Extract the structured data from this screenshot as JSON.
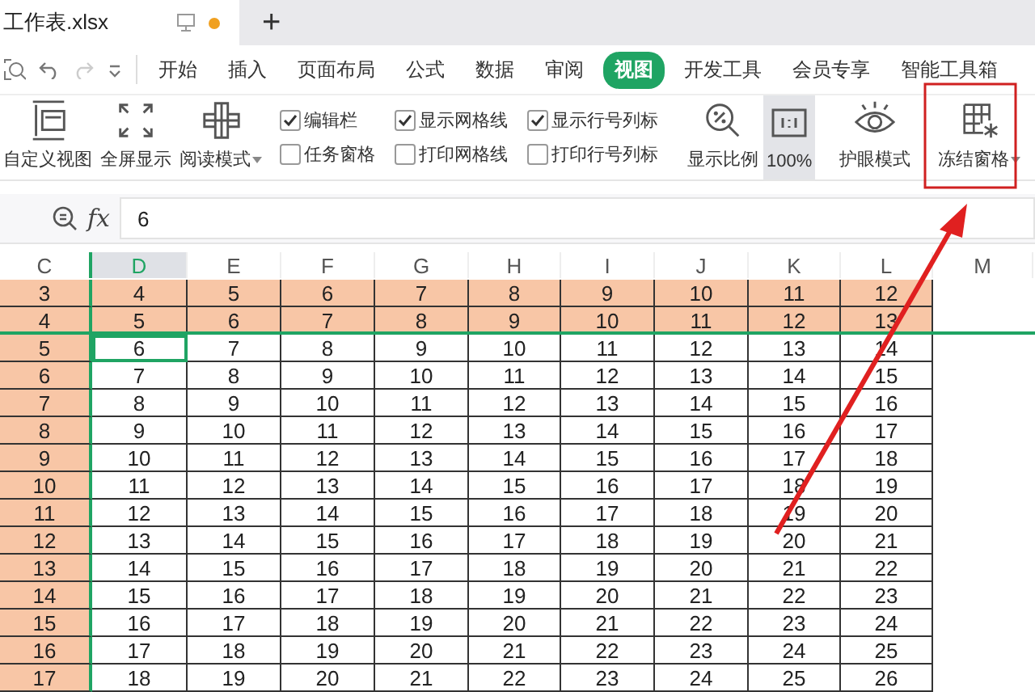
{
  "document_tab": {
    "title": "工作表.xlsx",
    "modified": true
  },
  "new_tab_button": "+",
  "menu_tabs": [
    {
      "label": "开始",
      "selected": false
    },
    {
      "label": "插入",
      "selected": false
    },
    {
      "label": "页面布局",
      "selected": false
    },
    {
      "label": "公式",
      "selected": false
    },
    {
      "label": "数据",
      "selected": false
    },
    {
      "label": "审阅",
      "selected": false
    },
    {
      "label": "视图",
      "selected": true
    },
    {
      "label": "开发工具",
      "selected": false
    },
    {
      "label": "会员专享",
      "selected": false
    },
    {
      "label": "智能工具箱",
      "selected": false
    }
  ],
  "ribbon": [
    {
      "kind": "button",
      "label": "自定义视图",
      "dropdown": false,
      "pressed": false
    },
    {
      "kind": "button",
      "label": "全屏显示",
      "dropdown": false,
      "pressed": false
    },
    {
      "kind": "button",
      "label": "阅读模式",
      "dropdown": true,
      "pressed": false
    },
    {
      "kind": "check",
      "label": "编辑栏",
      "checked": true
    },
    {
      "kind": "check",
      "label": "任务窗格",
      "checked": false
    },
    {
      "kind": "check",
      "label": "显示网格线",
      "checked": true
    },
    {
      "kind": "check",
      "label": "打印网格线",
      "checked": false
    },
    {
      "kind": "check",
      "label": "显示行号列标",
      "checked": true
    },
    {
      "kind": "check",
      "label": "打印行号列标",
      "checked": false
    },
    {
      "kind": "button",
      "label": "显示比例",
      "dropdown": false,
      "pressed": false
    },
    {
      "kind": "button",
      "label": "100%",
      "dropdown": false,
      "pressed": true
    },
    {
      "kind": "button",
      "label": "护眼模式",
      "dropdown": false,
      "pressed": false
    },
    {
      "kind": "button",
      "label": "冻结窗格",
      "dropdown": true,
      "pressed": false
    }
  ],
  "formula_bar": {
    "fx": "fx",
    "value": "6"
  },
  "sheet": {
    "columns": [
      {
        "label": "C",
        "selected": false,
        "frozen": true,
        "shaded": true
      },
      {
        "label": "D",
        "selected": true,
        "frozen": false,
        "shaded": false
      },
      {
        "label": "E",
        "selected": false,
        "frozen": false,
        "shaded": false
      },
      {
        "label": "F",
        "selected": false,
        "frozen": false,
        "shaded": false
      },
      {
        "label": "G",
        "selected": false,
        "frozen": false,
        "shaded": false
      },
      {
        "label": "H",
        "selected": false,
        "frozen": false,
        "shaded": false
      },
      {
        "label": "I",
        "selected": false,
        "frozen": false,
        "shaded": false
      },
      {
        "label": "J",
        "selected": false,
        "frozen": false,
        "shaded": false
      },
      {
        "label": "K",
        "selected": false,
        "frozen": false,
        "shaded": false
      },
      {
        "label": "L",
        "selected": false,
        "frozen": false,
        "shaded": false
      },
      {
        "label": "M",
        "selected": false,
        "frozen": false
      }
    ],
    "frozen_rows": [
      {
        "shaded": true,
        "selected": false,
        "cells": [
          "3",
          "4",
          "5",
          "6",
          "7",
          "8",
          "9",
          "10",
          "11",
          "12"
        ]
      },
      {
        "shaded": true,
        "selected": false,
        "cells": [
          "4",
          "5",
          "6",
          "7",
          "8",
          "9",
          "10",
          "11",
          "12",
          "13"
        ]
      }
    ],
    "rows": [
      {
        "shaded": false,
        "selected": true,
        "cells": [
          "5",
          "6",
          "7",
          "8",
          "9",
          "10",
          "11",
          "12",
          "13",
          "14"
        ]
      },
      {
        "shaded": false,
        "selected": false,
        "cells": [
          "6",
          "7",
          "8",
          "9",
          "10",
          "11",
          "12",
          "13",
          "14",
          "15"
        ]
      },
      {
        "shaded": false,
        "selected": false,
        "cells": [
          "7",
          "8",
          "9",
          "10",
          "11",
          "12",
          "13",
          "14",
          "15",
          "16"
        ]
      },
      {
        "shaded": false,
        "selected": false,
        "cells": [
          "8",
          "9",
          "10",
          "11",
          "12",
          "13",
          "14",
          "15",
          "16",
          "17"
        ]
      },
      {
        "shaded": false,
        "selected": false,
        "cells": [
          "9",
          "10",
          "11",
          "12",
          "13",
          "14",
          "15",
          "16",
          "17",
          "18"
        ]
      },
      {
        "shaded": false,
        "selected": false,
        "cells": [
          "10",
          "11",
          "12",
          "13",
          "14",
          "15",
          "16",
          "17",
          "18",
          "19"
        ]
      },
      {
        "shaded": false,
        "selected": false,
        "cells": [
          "11",
          "12",
          "13",
          "14",
          "15",
          "16",
          "17",
          "18",
          "19",
          "20"
        ]
      },
      {
        "shaded": false,
        "selected": false,
        "cells": [
          "12",
          "13",
          "14",
          "15",
          "16",
          "17",
          "18",
          "19",
          "20",
          "21"
        ]
      },
      {
        "shaded": false,
        "selected": false,
        "cells": [
          "13",
          "14",
          "15",
          "16",
          "17",
          "18",
          "19",
          "20",
          "21",
          "22"
        ]
      },
      {
        "shaded": false,
        "selected": false,
        "cells": [
          "14",
          "15",
          "16",
          "17",
          "18",
          "19",
          "20",
          "21",
          "22",
          "23"
        ]
      },
      {
        "shaded": false,
        "selected": false,
        "cells": [
          "15",
          "16",
          "17",
          "18",
          "19",
          "20",
          "21",
          "22",
          "23",
          "24"
        ]
      },
      {
        "shaded": false,
        "selected": false,
        "cells": [
          "16",
          "17",
          "18",
          "19",
          "20",
          "21",
          "22",
          "23",
          "24",
          "25"
        ]
      },
      {
        "shaded": false,
        "selected": false,
        "cells": [
          "17",
          "18",
          "19",
          "20",
          "21",
          "22",
          "23",
          "24",
          "25",
          "26"
        ]
      }
    ]
  }
}
